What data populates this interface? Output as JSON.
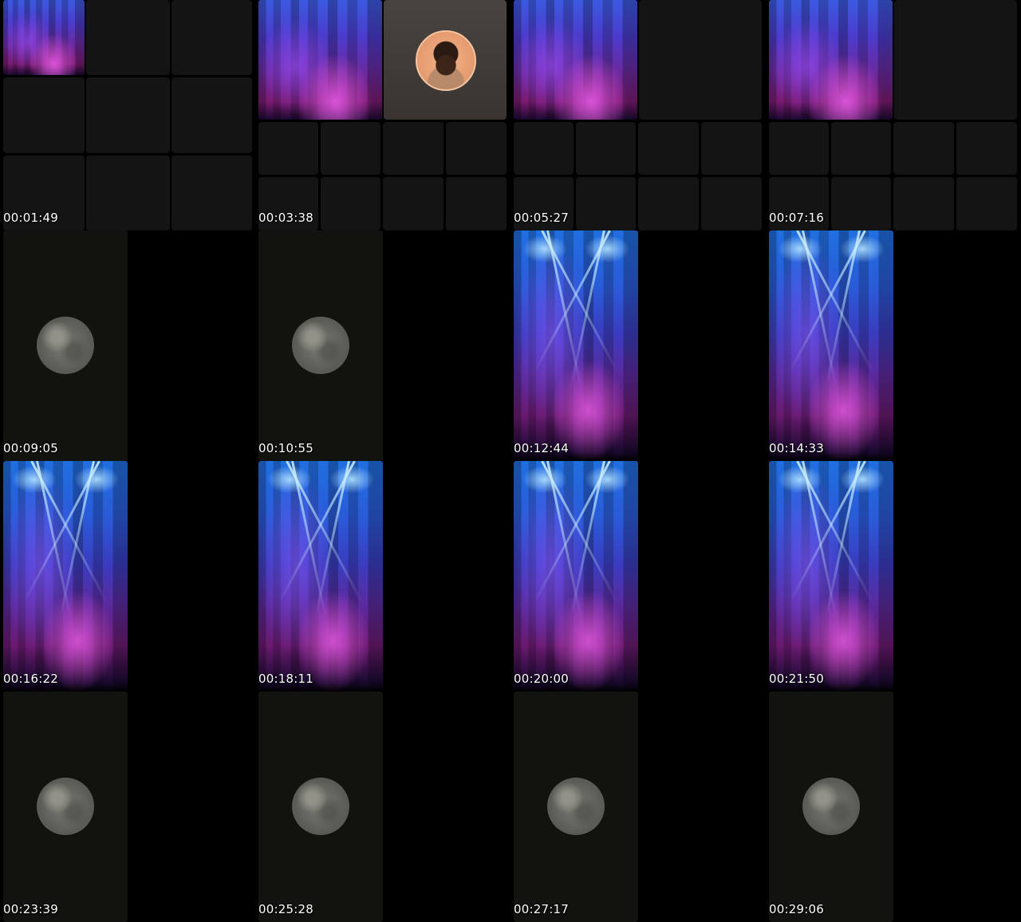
{
  "timestamps": [
    "00:01:49",
    "00:03:38",
    "00:05:27",
    "00:07:16",
    "00:09:05",
    "00:10:55",
    "00:12:44",
    "00:14:33",
    "00:16:22",
    "00:18:11",
    "00:20:00",
    "00:21:50",
    "00:23:39",
    "00:25:28",
    "00:27:17",
    "00:29:06"
  ],
  "thumbnails": [
    {
      "content": "video-call-grid",
      "active_participant": "stage-lights"
    },
    {
      "content": "video-call-grid",
      "active_participant": "stage-lights",
      "second_participant": "avatar"
    },
    {
      "content": "video-call-grid",
      "active_participant": "stage-lights"
    },
    {
      "content": "video-call-grid",
      "active_participant": "stage-lights"
    },
    {
      "content": "moon"
    },
    {
      "content": "moon"
    },
    {
      "content": "stage-lights"
    },
    {
      "content": "stage-lights"
    },
    {
      "content": "stage-lights"
    },
    {
      "content": "stage-lights"
    },
    {
      "content": "stage-lights"
    },
    {
      "content": "stage-lights"
    },
    {
      "content": "moon"
    },
    {
      "content": "moon"
    },
    {
      "content": "moon"
    },
    {
      "content": "moon"
    }
  ],
  "colors": {
    "background": "#000000",
    "tile": "#141414",
    "stage_blue": "#1f6fe0",
    "stage_magenta": "#e65ae6",
    "moon_panel": "#12130f",
    "moon": "#6a6b64"
  }
}
